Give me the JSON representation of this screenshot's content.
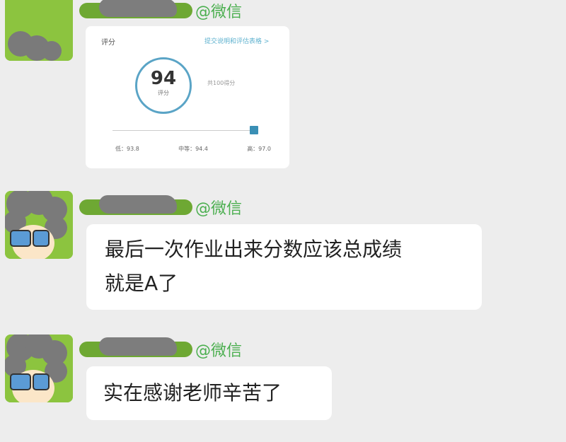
{
  "messages": [
    {
      "sender_suffix": "@微信",
      "type": "image",
      "card": {
        "title": "评分",
        "link": "提交说明和评估表格 >",
        "score": "94",
        "score_label": "评分",
        "total": "共100得分",
        "low": "低：93.8",
        "mid": "中等：94.4",
        "high": "高：97.0"
      }
    },
    {
      "sender_suffix": "@微信",
      "type": "text",
      "text": "最后一次作业出来分数应该总成绩\n就是A了"
    },
    {
      "sender_suffix": "@微信",
      "type": "text",
      "text": "实在感谢老师辛苦了"
    }
  ],
  "colors": {
    "background": "#ededed",
    "bubble": "#ffffff",
    "sender_tag": "#4caf50",
    "avatar_bg": "#8cc43f",
    "ring": "#5aa4c6"
  }
}
